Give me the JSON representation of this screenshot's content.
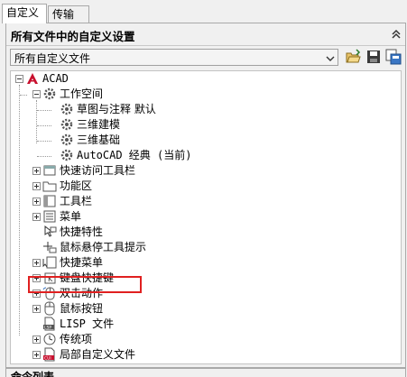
{
  "tabs": [
    {
      "label": "自定义",
      "active": true
    },
    {
      "label": "传输",
      "active": false
    }
  ],
  "panel": {
    "title": "所有文件中的自定义设置",
    "collapse_icon": "double-chevron-up-icon"
  },
  "toolbar": {
    "select_value": "所有自定义文件",
    "buttons": [
      "open-file-icon",
      "save-icon",
      "load-partial-icon"
    ]
  },
  "tree": [
    {
      "label": "ACAD",
      "icon": "acad-logo-icon",
      "expanded": true
    },
    {
      "label": "工作空间",
      "icon": "gear-icon",
      "expanded": true
    },
    {
      "label": "草图与注释 默认",
      "icon": "gear-icon"
    },
    {
      "label": "三维建模",
      "icon": "gear-icon"
    },
    {
      "label": "三维基础",
      "icon": "gear-icon"
    },
    {
      "label": "AutoCAD 经典 (当前)",
      "icon": "gear-icon"
    },
    {
      "label": "快速访问工具栏",
      "icon": "toolbar-icon",
      "expanded": false
    },
    {
      "label": "功能区",
      "icon": "folder-icon",
      "expanded": false
    },
    {
      "label": "工具栏",
      "icon": "toolbar-icon",
      "expanded": false
    },
    {
      "label": "菜单",
      "icon": "menu-icon",
      "expanded": false
    },
    {
      "label": "快捷特性",
      "icon": "quick-properties-icon"
    },
    {
      "label": "鼠标悬停工具提示",
      "icon": "rollover-tooltip-icon"
    },
    {
      "label": "快捷菜单",
      "icon": "shortcut-menu-icon",
      "expanded": false
    },
    {
      "label": "键盘快捷键",
      "icon": "keyboard-icon",
      "expanded": false
    },
    {
      "label": "双击动作",
      "icon": "mouse-double-click-icon",
      "expanded": false,
      "highlighted": true
    },
    {
      "label": "鼠标按钮",
      "icon": "mouse-icon",
      "expanded": false
    },
    {
      "label": "LISP 文件",
      "icon": "lisp-file-icon"
    },
    {
      "label": "传统项",
      "icon": "legacy-clock-icon",
      "expanded": false
    },
    {
      "label": "局部自定义文件",
      "icon": "cui-file-icon",
      "expanded": false
    }
  ],
  "bottom_panel": {
    "title": "命令列表"
  },
  "colors": {
    "acad_red": "#c8102e",
    "highlight": "#e02020"
  }
}
